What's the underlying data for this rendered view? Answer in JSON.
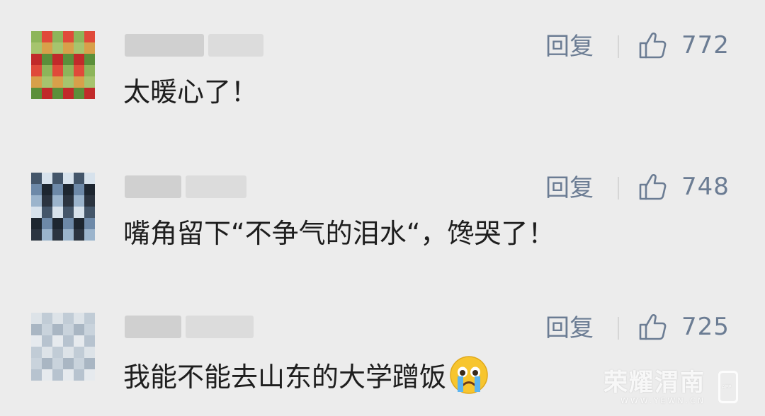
{
  "comments": [
    {
      "text": "太暖心了！",
      "reply_label": "回复",
      "likes": "772",
      "avatar_palette": [
        "#8db55a",
        "#a6c46e",
        "#c12a2a",
        "#e04a3a",
        "#d8a04a",
        "#5b8f3a"
      ]
    },
    {
      "text": "嘴角留下“不争气的泪水“，馋哭了！",
      "reply_label": "回复",
      "likes": "748",
      "avatar_palette": [
        "#2b3440",
        "#44566a",
        "#6d89a8",
        "#9bb4cc",
        "#d7e2ec",
        "#1d2630"
      ]
    },
    {
      "text": "我能不能去山东的大学蹭饭",
      "reply_label": "回复",
      "likes": "725",
      "emoji": "crying-face",
      "avatar_palette": [
        "#c9d3dc",
        "#b7c3cf",
        "#dde3e8",
        "#a9b6c3",
        "#e6eaee",
        "#c1ccd6"
      ]
    }
  ],
  "watermark": {
    "title": "荣耀渭南",
    "url": "WWW.YEWN.CN",
    "badge": "APP"
  },
  "colors": {
    "background": "#ececec",
    "text": "#1e1e1e",
    "action": "#6b7c93"
  }
}
